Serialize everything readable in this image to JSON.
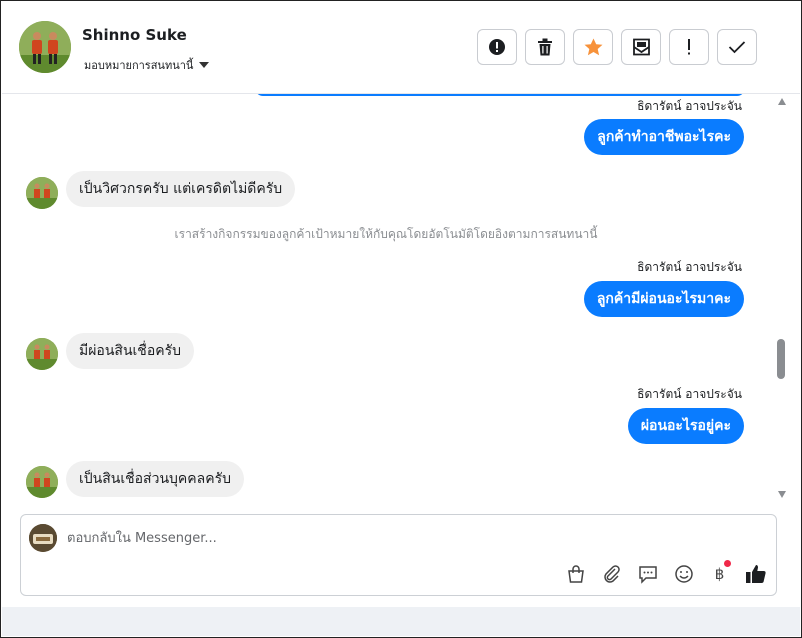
{
  "header": {
    "contact_name": "Shinno Suke",
    "assign_label": "มอบหมายการสนทนานี้",
    "action_icons": [
      "alert-circle-icon",
      "trash-icon",
      "star-icon",
      "envelope-icon",
      "exclamation-icon",
      "check-icon"
    ],
    "star_color": "#f7923b"
  },
  "chat": {
    "messages": [
      {
        "type": "out",
        "sender": "ธิดารัตน์ อาจประจัน",
        "text": "ลูกค้าทำอาชีพอะไรคะ"
      },
      {
        "type": "in",
        "text": "เป็นวิศวกรครับ แต่เครดิตไม่ดีครับ"
      },
      {
        "type": "system",
        "text": "เราสร้างกิจกรรมของลูกค้าเป้าหมายให้กับคุณโดยอัตโนมัติโดยอิงตามการสนทนานี้"
      },
      {
        "type": "out",
        "sender": "ธิดารัตน์ อาจประจัน",
        "text": "ลูกค้ามีผ่อนอะไรมาคะ"
      },
      {
        "type": "in",
        "text": "มีผ่อนสินเชื่อครับ"
      },
      {
        "type": "out",
        "sender": "ธิดารัตน์ อาจประจัน",
        "text": "ผ่อนอะไรอยู่คะ"
      },
      {
        "type": "in",
        "text": "เป็นสินเชื่อส่วนบุคคลครับ"
      }
    ],
    "bubble_color": "#0a7cff"
  },
  "composer": {
    "placeholder": "ตอบกลับใน Messenger...",
    "value": "",
    "tool_icons": [
      "bag-icon",
      "paperclip-icon",
      "speech-bubble-icon",
      "smiley-icon",
      "baht-icon",
      "thumbs-up-icon"
    ],
    "baht_symbol": "฿"
  }
}
